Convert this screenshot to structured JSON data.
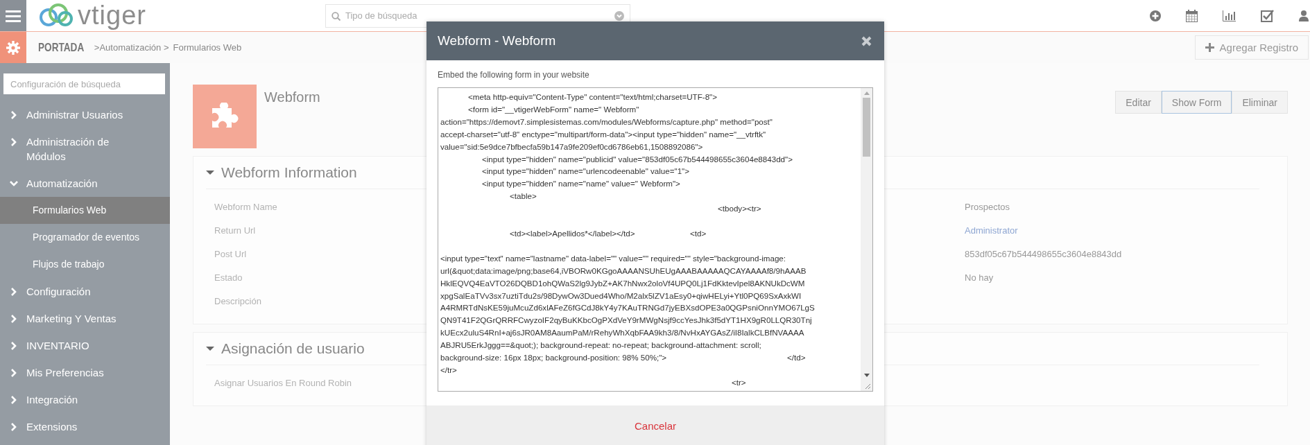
{
  "top_bar": {
    "logo": "vtiger",
    "search": {
      "placeholder": "Tipo de búsqueda"
    }
  },
  "breadcrumb": [
    "PORTADA",
    ">Automatización >",
    "Formularios Web"
  ],
  "add_record_button": "Agregar Registro",
  "sidebar": {
    "search": {
      "placeholder": "Configuración de búsqueda"
    },
    "items": [
      {
        "label": "Administrar Usuarios",
        "expanded": false
      },
      {
        "label": "Administración de Módulos",
        "expanded": false
      },
      {
        "label": "Automatización",
        "expanded": true,
        "children": [
          {
            "label": "Formularios Web",
            "selected": true
          },
          {
            "label": "Programador de eventos",
            "selected": false
          },
          {
            "label": "Flujos de trabajo",
            "selected": false
          }
        ]
      },
      {
        "label": "Configuración",
        "expanded": false
      },
      {
        "label": "Marketing Y Ventas",
        "expanded": false
      },
      {
        "label": "INVENTARIO",
        "expanded": false
      },
      {
        "label": "Mis Preferencias",
        "expanded": false
      },
      {
        "label": "Integración",
        "expanded": false
      },
      {
        "label": "Extensions",
        "expanded": false
      }
    ]
  },
  "record": {
    "title": "Webform",
    "actions": [
      {
        "label": "Editar",
        "selected": false
      },
      {
        "label": "Show Form",
        "selected": true
      },
      {
        "label": "Eliminar",
        "selected": false
      }
    ]
  },
  "sections": [
    {
      "title": "Webform Information",
      "expanded": true,
      "fields": [
        {
          "label": "Webform Name",
          "right_value": "Prospectos",
          "kind": "text"
        },
        {
          "label": "Return Url",
          "right_value": "Administrator",
          "kind": "link"
        },
        {
          "label": "Post Url",
          "right_value": "853df05c67b544498655c3604e8843dd",
          "kind": "text"
        },
        {
          "label": "Estado",
          "right_value": "No hay",
          "kind": "text"
        },
        {
          "label": "Descripción"
        }
      ]
    },
    {
      "title": "Asignación de usuario",
      "expanded": true,
      "fields": [
        {
          "label": "Asignar Usuarios En Round Robin"
        }
      ]
    }
  ],
  "modal": {
    "title": "Webform - Webform",
    "intro": "Embed the following form in your website",
    "code": "\t\t<meta http-equiv=\"Content-Type\" content=\"text/html;charset=UTF-8\">\n\t\t<form id=\"__vtigerWebForm\" name=\" Webform\"\naction=\"https://demovt7.simplesistemas.com/modules/Webforms/capture.php\" method=\"post\"\naccept-charset=\"utf-8\" enctype=\"multipart/form-data\"><input type=\"hidden\" name=\"__vtrftk\"\nvalue=\"sid:5e9dce7bfbecfa59b147a9fe209ef0cd6786eb61,1508892086\">\n\t\t\t<input type=\"hidden\" name=\"publicid\" value=\"853df05c67b544498655c3604e8843dd\">\n\t\t\t<input type=\"hidden\" name=\"urlencodeenable\" value=\"1\">\n\t\t\t<input type=\"hidden\" name=\"name\" value=\" Webform\">\n\t\t\t\t\t<table>\n\t\t\t\t\t\t\t\t\t\t\t\t\t\t\t\t\t\t\t\t<tbody><tr>\n\n\t\t\t\t\t<td><label>Apellidos*</label></td>\t\t\t\t<td>\n\n<input type=\"text\" name=\"lastname\" data-label=\"\" value=\"\" required=\"\" style=\"background-image:\nurl(&quot;data:image/png;base64,iVBORw0KGgoAAAANSUhEUgAAABAAAAAQCAYAAAAf8/9hAAAB\nHklEQVQ4EaVTO26DQBD1ohQWaS2lg9JybZ+AK7hNwx2oloVf4UPQ0Lj1FdKktevIpel8AKNUkDcWM\nxpgSalEaTVv3sx7uztiTdu2s/98DywOw3Dued4Who/M2alx5lZV1aEsy0+qiwHELyi+Ytl0PQ69SxAxkWI\nA4RMRTdNsKE59juMcuZd6xlAFeZ6fGCdJ8kY4y7KAuTRNGd7jyEBXsdOPE3a0QGPsniOnnYMO67LgS\nQN9T41F2QGrQRRFCwyzoIF2qyBuKKbcOgPXdVeY9rMWgNsjf9ccYesJhk3f5dYT1HX9gR0LLQR30Tnj\nkUEcx2uluS4RnI+aj6sJR0AM8AaumPaM/rRehyWhXqbFAA9kh3/8/NvHxAYGAsZ/iI8IalkCLBfNVAAAA\nABJRU5ErkJggg==&quot;); background-repeat: no-repeat; background-attachment: scroll;\nbackground-size: 16px 18px; background-position: 98% 50%;\">\t\t\t\t\t\t\t\t\t</td>\n</tr>\n\t\t\t\t\t\t\t\t\t\t\t\t\t\t\t\t\t\t\t\t\t<tr>",
    "cancel_button": "Cancelar"
  }
}
